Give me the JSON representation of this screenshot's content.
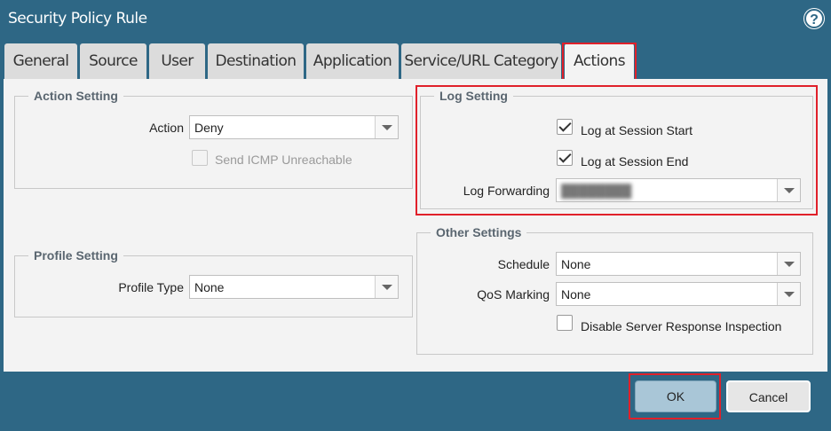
{
  "dialog": {
    "title": "Security Policy Rule"
  },
  "tabs": [
    {
      "label": "General"
    },
    {
      "label": "Source"
    },
    {
      "label": "User"
    },
    {
      "label": "Destination"
    },
    {
      "label": "Application"
    },
    {
      "label": "Service/URL Category"
    },
    {
      "label": "Actions",
      "active": true
    }
  ],
  "action_setting": {
    "legend": "Action Setting",
    "action_label": "Action",
    "action_value": "Deny",
    "send_icmp_label": "Send ICMP Unreachable",
    "send_icmp_checked": false,
    "send_icmp_disabled": true
  },
  "profile_setting": {
    "legend": "Profile Setting",
    "profile_type_label": "Profile Type",
    "profile_type_value": "None"
  },
  "log_setting": {
    "legend": "Log Setting",
    "log_start_label": "Log at Session Start",
    "log_start_checked": true,
    "log_end_label": "Log at Session End",
    "log_end_checked": true,
    "log_forwarding_label": "Log Forwarding",
    "log_forwarding_value": "████████"
  },
  "other_settings": {
    "legend": "Other Settings",
    "schedule_label": "Schedule",
    "schedule_value": "None",
    "qos_label": "QoS Marking",
    "qos_value": "None",
    "disable_sri_label": "Disable Server Response Inspection",
    "disable_sri_checked": false
  },
  "footer": {
    "ok_label": "OK",
    "cancel_label": "Cancel"
  },
  "colors": {
    "background": "#2e6785",
    "panel": "#f3f3f3",
    "highlight": "#e0202a"
  },
  "icons": {
    "help": "help-icon",
    "dropdown": "chevron-down-icon"
  }
}
